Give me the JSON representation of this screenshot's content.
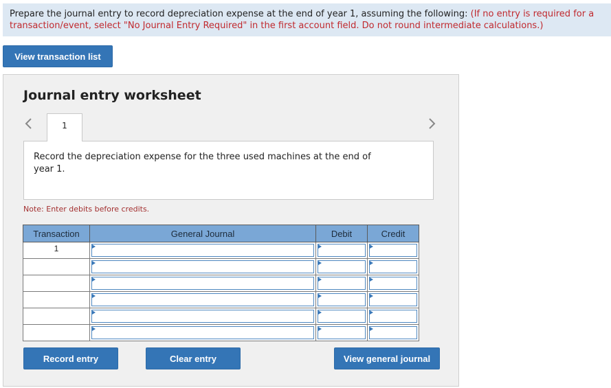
{
  "instructions": {
    "text": "Prepare the journal entry to record depreciation expense at the end of year 1, assuming the following: ",
    "note": "(If no entry is required for a transaction/event, select \"No Journal Entry Required\" in the first account field. Do not round intermediate calculations.)"
  },
  "view_transaction_list_label": "View transaction list",
  "worksheet": {
    "title": "Journal entry worksheet",
    "tab_label": "1",
    "description": "Record the depreciation expense for the three used machines at the end of year 1.",
    "note": "Note: Enter debits before credits."
  },
  "table": {
    "headers": [
      "Transaction",
      "General Journal",
      "Debit",
      "Credit"
    ],
    "rows": [
      {
        "transaction": "1",
        "general_journal": "",
        "debit": "",
        "credit": ""
      },
      {
        "transaction": "",
        "general_journal": "",
        "debit": "",
        "credit": ""
      },
      {
        "transaction": "",
        "general_journal": "",
        "debit": "",
        "credit": ""
      },
      {
        "transaction": "",
        "general_journal": "",
        "debit": "",
        "credit": ""
      },
      {
        "transaction": "",
        "general_journal": "",
        "debit": "",
        "credit": ""
      },
      {
        "transaction": "",
        "general_journal": "",
        "debit": "",
        "credit": ""
      }
    ]
  },
  "buttons": {
    "record_entry": "Record entry",
    "clear_entry": "Clear entry",
    "view_general_journal": "View general journal"
  },
  "icons": {
    "prev": "chevron-left-icon",
    "next": "chevron-right-icon"
  },
  "colors": {
    "button": "#3475b6",
    "header": "#7aa7d6",
    "instruction_bg": "#dde8f3",
    "note_red": "#c0292e"
  }
}
